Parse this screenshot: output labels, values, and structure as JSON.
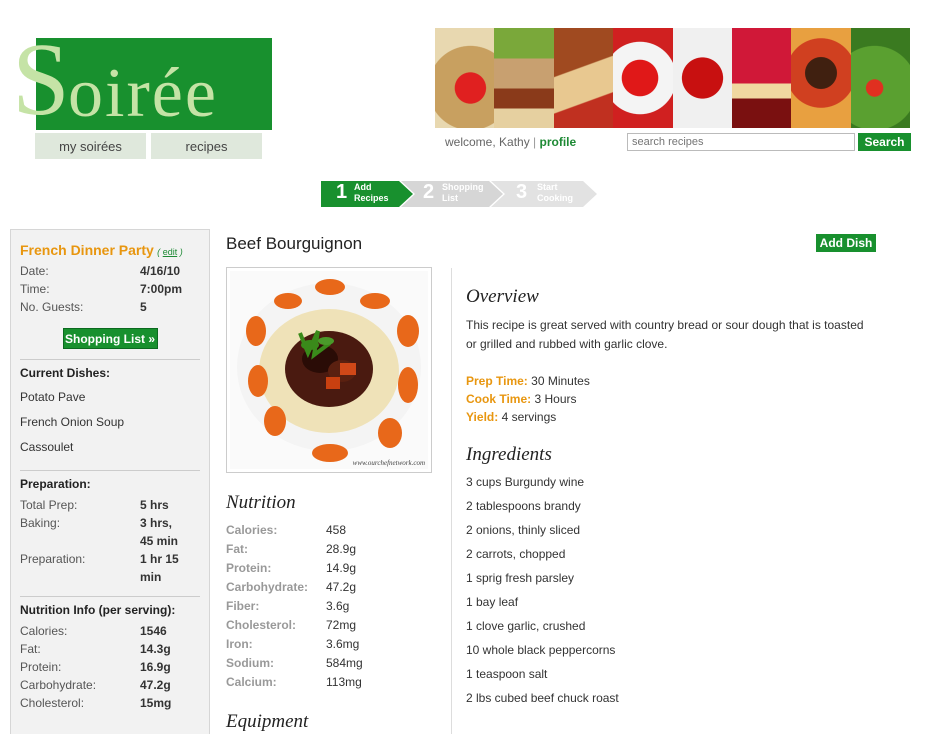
{
  "brand": {
    "logo_text": "Soirée",
    "primary_color": "#18902e",
    "accent_color": "#e8960f"
  },
  "nav": {
    "my_soirees": "my soirées",
    "recipes": "recipes"
  },
  "user": {
    "welcome": "welcome, Kathy",
    "separator": "|",
    "profile": "profile"
  },
  "search": {
    "placeholder": "search recipes",
    "button": "Search"
  },
  "steps": [
    {
      "num": "1",
      "line1": "Add",
      "line2": "Recipes",
      "active": true
    },
    {
      "num": "2",
      "line1": "Shopping",
      "line2": "List",
      "active": false
    },
    {
      "num": "3",
      "line1": "Start",
      "line2": "Cooking",
      "active": false
    }
  ],
  "sidebar": {
    "party_title": "French Dinner Party",
    "edit_open": "(",
    "edit": "edit",
    "edit_close": ")",
    "date_label": "Date:",
    "date": "4/16/10",
    "time_label": "Time:",
    "time": "7:00pm",
    "guests_label": "No. Guests:",
    "guests": "5",
    "shopping_button": "Shopping List »",
    "current_dishes_heading": "Current Dishes:",
    "dishes": [
      "Potato Pave",
      "French Onion Soup",
      "Cassoulet"
    ],
    "prep_heading": "Preparation:",
    "prep": [
      {
        "label": "Total Prep:",
        "value": "5 hrs"
      },
      {
        "label": "Baking:",
        "value": "3 hrs,",
        "value2": "45 min"
      },
      {
        "label": "Preparation:",
        "value": "1 hr 15",
        "value2": "min"
      }
    ],
    "nutrition_heading": "Nutrition Info (per serving):",
    "nutrition": [
      {
        "label": "Calories:",
        "value": "1546"
      },
      {
        "label": "Fat:",
        "value": "14.3g"
      },
      {
        "label": "Protein:",
        "value": "16.9g"
      },
      {
        "label": "Carbohydrate:",
        "value": "47.2g"
      },
      {
        "label": "Cholesterol:",
        "value": "15mg"
      }
    ]
  },
  "recipe": {
    "title": "Beef Bourguignon",
    "add_dish": "Add Dish",
    "photo_credit": "www.ourchefnetwork.com",
    "nutrition_heading": "Nutrition",
    "nutrition": [
      {
        "label": "Calories:",
        "value": "458"
      },
      {
        "label": "Fat:",
        "value": "28.9g"
      },
      {
        "label": "Protein:",
        "value": "14.9g"
      },
      {
        "label": "Carbohydrate:",
        "value": "47.2g"
      },
      {
        "label": "Fiber:",
        "value": "3.6g"
      },
      {
        "label": "Cholesterol:",
        "value": "72mg"
      },
      {
        "label": "Iron:",
        "value": "3.6mg"
      },
      {
        "label": "Sodium:",
        "value": "584mg"
      },
      {
        "label": "Calcium:",
        "value": "113mg"
      }
    ],
    "equipment_heading": "Equipment",
    "overview_heading": "Overview",
    "overview": "This recipe is great served with country bread or sour dough that is toasted or grilled and rubbed with garlic clove.",
    "prep_time_label": "Prep Time:",
    "prep_time": "30 Minutes",
    "cook_time_label": "Cook Time:",
    "cook_time": "3 Hours",
    "yield_label": "Yield:",
    "yield": "4 servings",
    "ingredients_heading": "Ingredients",
    "ingredients": [
      "3 cups Burgundy wine",
      "2 tablespoons brandy",
      "2 onions, thinly sliced",
      "2 carrots, chopped",
      "1 sprig fresh parsley",
      "1 bay leaf",
      "1 clove garlic, crushed",
      "10 whole black peppercorns",
      "1 teaspoon salt",
      "2 lbs cubed beef chuck roast"
    ]
  }
}
